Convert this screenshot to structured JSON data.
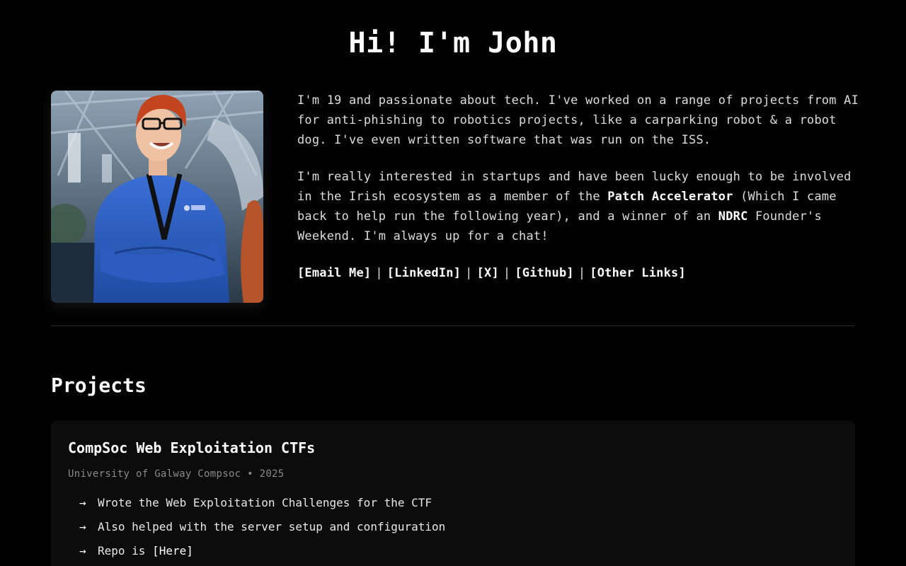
{
  "header": {
    "title": "Hi! I'm John"
  },
  "bio": {
    "p1": "I'm 19 and passionate about tech. I've worked on a range of projects from AI for anti-phishing to robotics projects, like a carparking robot & a robot dog. I've even written software that was run on the ISS.",
    "p2_a": "I'm really interested in startups and have been lucky enough to be involved in the Irish ecosystem as a member of the ",
    "p2_strong1": "Patch Accelerator",
    "p2_b": " (Which I came back to help run the following year), and a winner of an ",
    "p2_strong2": "NDRC",
    "p2_c": " Founder's Weekend. I'm always up for a chat!"
  },
  "links": {
    "email": "[Email Me]",
    "linkedin": "[LinkedIn]",
    "x": "[X]",
    "github": "[Github]",
    "other": "[Other Links]",
    "separator": "|"
  },
  "projects": {
    "heading": "Projects",
    "items": [
      {
        "title": "CompSoc Web Exploitation CTFs",
        "meta": "University of Galway Compsoc • 2025",
        "bullets": [
          "Wrote the Web Exploitation Challenges for the CTF",
          "Also helped with the server setup and configuration"
        ],
        "repo_prefix": "Repo is ",
        "repo_link": "[Here]"
      }
    ]
  },
  "icons": {
    "arrow": "→"
  },
  "colors": {
    "background": "#020203",
    "card": "#0c0c0d",
    "text": "#dcdcdc",
    "muted": "#8a8a8a",
    "shirt": "#2f5fc4"
  }
}
